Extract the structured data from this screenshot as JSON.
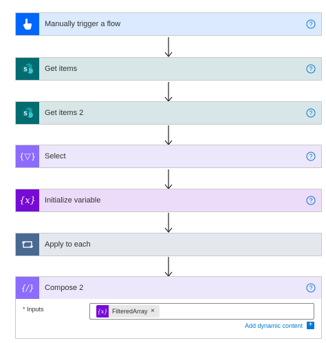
{
  "steps": [
    {
      "title": "Manually trigger a flow",
      "icon": "touch-hand-icon"
    },
    {
      "title": "Get items",
      "icon": "sharepoint-icon"
    },
    {
      "title": "Get items 2",
      "icon": "sharepoint-icon"
    },
    {
      "title": "Select",
      "icon": "data-operation-icon"
    },
    {
      "title": "Initialize variable",
      "icon": "variable-icon"
    },
    {
      "title": "Apply to each",
      "icon": "loop-icon"
    },
    {
      "title": "Compose 2",
      "icon": "compose-icon"
    }
  ],
  "compose": {
    "inputs_required_mark": "*",
    "inputs_label": "Inputs",
    "token_label": "FilteredArray",
    "token_close": "×",
    "add_dynamic_label": "Add dynamic content",
    "add_dynamic_plus": "+"
  },
  "colors": {
    "trigger_icon": "#0066ff",
    "trigger_header": "#dbeafe",
    "sharepoint_icon": "#036c70",
    "sharepoint_header": "#d8e6e8",
    "select_icon": "#8c6cff",
    "select_header": "#ede7fb",
    "variable_icon": "#770bd6",
    "variable_header": "#ecdcf9",
    "loop_icon": "#486991",
    "loop_header": "#e4e8ee",
    "compose_icon": "#8c6cff",
    "compose_header": "#ede7fb",
    "link": "#0078d4"
  }
}
